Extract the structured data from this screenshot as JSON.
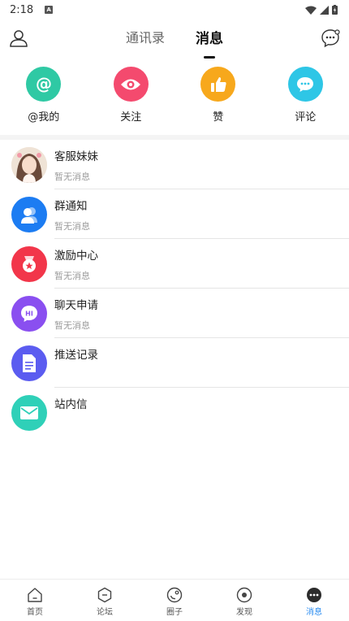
{
  "status_bar": {
    "time": "2:18"
  },
  "header": {
    "tabs": [
      {
        "label": "通讯录",
        "active": false
      },
      {
        "label": "消息",
        "active": true
      }
    ]
  },
  "quick_actions": [
    {
      "label": "@我的",
      "icon": "at-icon",
      "color": "#2fc9a4"
    },
    {
      "label": "关注",
      "icon": "eye-icon",
      "color": "#f44a6e"
    },
    {
      "label": "赞",
      "icon": "thumbs-up-icon",
      "color": "#f7a81c"
    },
    {
      "label": "评论",
      "icon": "comment-icon",
      "color": "#2ec6e6"
    }
  ],
  "messages": [
    {
      "title": "客服妹妹",
      "subtitle": "暂无消息",
      "icon": "customer-service-avatar"
    },
    {
      "title": "群通知",
      "subtitle": "暂无消息",
      "icon": "group-icon",
      "color": "#1c7cf2"
    },
    {
      "title": "激励中心",
      "subtitle": "暂无消息",
      "icon": "reward-icon",
      "color": "#f2364a"
    },
    {
      "title": "聊天申请",
      "subtitle": "暂无消息",
      "icon": "hi-chat-icon",
      "color": "#8a4ff0"
    },
    {
      "title": "推送记录",
      "subtitle": "",
      "icon": "document-icon",
      "color": "#5b5cf0"
    },
    {
      "title": "站内信",
      "subtitle": "",
      "icon": "mail-icon",
      "color": "#2fd0b8"
    }
  ],
  "bottom_nav": [
    {
      "label": "首页",
      "icon": "home-icon",
      "active": false
    },
    {
      "label": "论坛",
      "icon": "forum-icon",
      "active": false
    },
    {
      "label": "圈子",
      "icon": "circle-icon",
      "active": false
    },
    {
      "label": "发现",
      "icon": "discover-icon",
      "active": false
    },
    {
      "label": "消息",
      "icon": "message-icon",
      "active": true
    }
  ]
}
